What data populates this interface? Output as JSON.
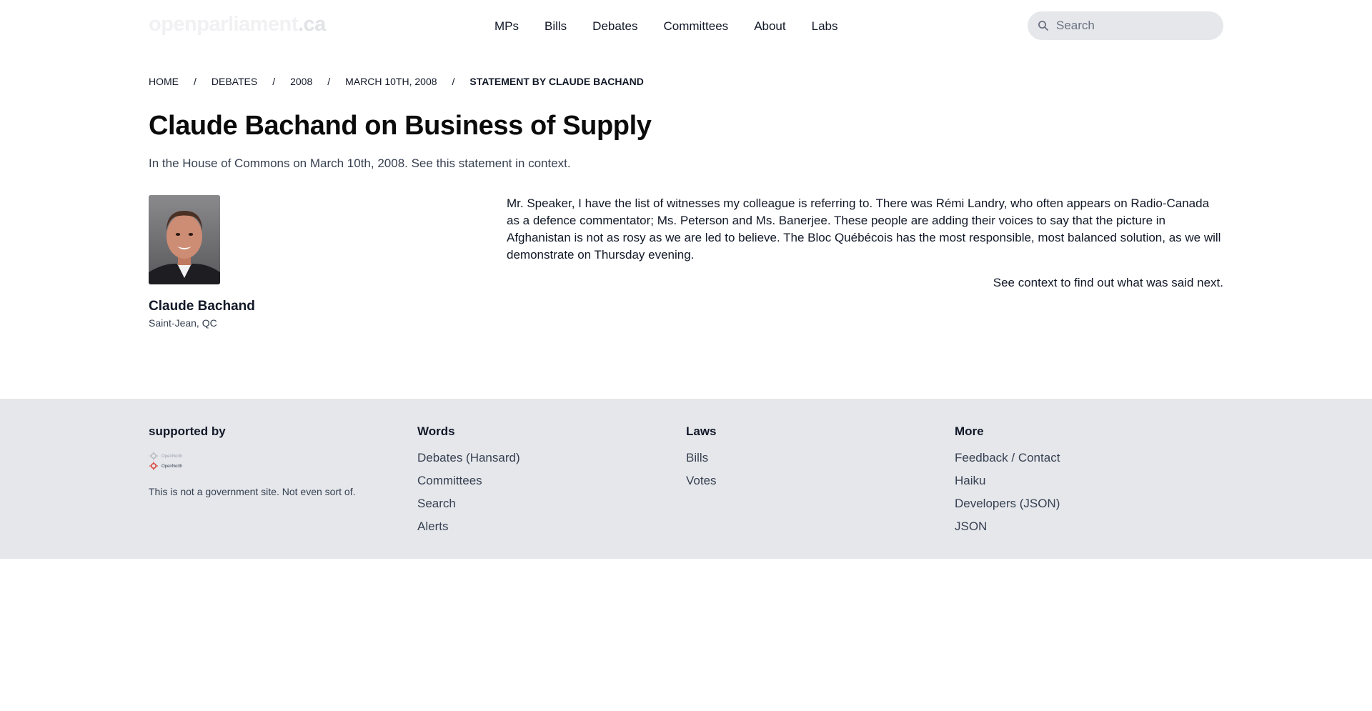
{
  "header": {
    "logo": {
      "main": "openparliament",
      "tld": ".ca"
    },
    "nav": [
      "MPs",
      "Bills",
      "Debates",
      "Committees",
      "About",
      "Labs"
    ],
    "search_placeholder": "Search"
  },
  "breadcrumb": [
    "Home",
    "Debates",
    "2008",
    "March 10th, 2008",
    "Statement by Claude Bachand"
  ],
  "page": {
    "title": "Claude Bachand on Business of Supply",
    "subtitle": "In the House of Commons on March 10th, 2008. See this statement in context."
  },
  "mp": {
    "name": "Claude Bachand",
    "riding": "Saint-Jean, QC"
  },
  "statement": {
    "text": "Mr. Speaker, I have the list of witnesses my colleague is referring to. There was Rémi Landry, who often appears on Radio-Canada as a defence commentator; Ms. Peterson and Ms. Banerjee. These people are adding their voices to say that the picture in Afghanistan is not as rosy as we are led to believe. The Bloc Québécois has the most responsible, most balanced solution, as we will demonstrate on Thursday evening.",
    "context_note": "See context to find out what was said next."
  },
  "footer": {
    "supported": {
      "heading": "supported by",
      "sponsor_lines": [
        "OpenNorth",
        "OpenNorth"
      ],
      "disclaimer": "This is not a government site. Not even sort of."
    },
    "words": {
      "heading": "Words",
      "links": [
        "Debates (Hansard)",
        "Committees",
        "Search",
        "Alerts"
      ]
    },
    "laws": {
      "heading": "Laws",
      "links": [
        "Bills",
        "Votes"
      ]
    },
    "more": {
      "heading": "More",
      "links": [
        "Feedback / Contact",
        "Haiku",
        "Developers (JSON)",
        "JSON"
      ]
    }
  },
  "icons": {
    "search": "search-icon",
    "sponsor": "opennorth-logo",
    "portrait": "mp-photo"
  },
  "colors": {
    "footer_bg": "#e5e7eb",
    "search_bg": "#e5e7eb",
    "text": "#111827",
    "muted": "#374151"
  }
}
